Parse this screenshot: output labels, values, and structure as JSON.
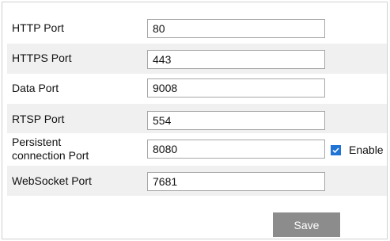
{
  "ports": [
    {
      "label": "HTTP Port",
      "value": "80"
    },
    {
      "label": "HTTPS Port",
      "value": "443"
    },
    {
      "label": "Data Port",
      "value": "9008"
    },
    {
      "label": "RTSP Port",
      "value": "554"
    },
    {
      "label_line1": "Persistent",
      "label_line2": "connection Port",
      "value": "8080",
      "enable_label": "Enable",
      "enable_checked": true
    },
    {
      "label": "WebSocket Port",
      "value": "7681"
    }
  ],
  "save_label": "Save",
  "colors": {
    "row_shade": "#f0f0f0",
    "checkbox": "#1f74d6",
    "button": "#8c8c8c",
    "field_border": "#a6a6a6"
  },
  "icons": {
    "checkmark": "checkmark-icon"
  }
}
